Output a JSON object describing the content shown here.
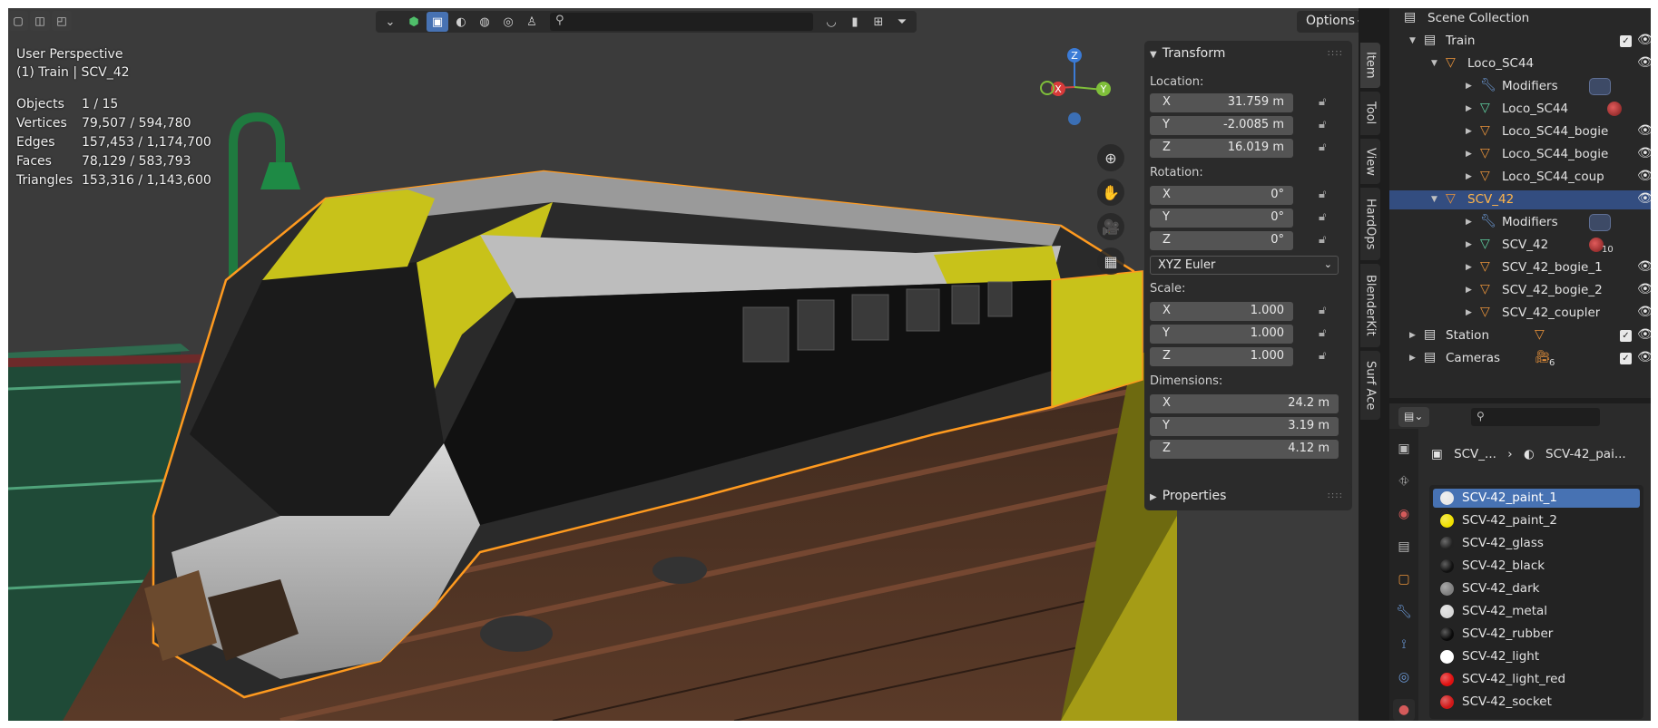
{
  "header": {
    "search_placeholder": "",
    "options_label": "Options",
    "search_icon": "search-icon"
  },
  "viewport": {
    "view_name": "User Perspective",
    "active_object": "(1) Train | SCV_42",
    "stats": [
      {
        "label": "Objects",
        "value": "1 / 15"
      },
      {
        "label": "Vertices",
        "value": "79,507 / 594,780"
      },
      {
        "label": "Edges",
        "value": "157,453 / 1,174,700"
      },
      {
        "label": "Faces",
        "value": "78,129 / 583,793"
      },
      {
        "label": "Triangles",
        "value": "153,316 / 1,143,600"
      }
    ],
    "gizmo": {
      "x": "X",
      "y": "Y",
      "z": "Z"
    }
  },
  "npanel": {
    "transform_title": "Transform",
    "location_label": "Location:",
    "location": [
      {
        "axis": "X",
        "value": "31.759 m"
      },
      {
        "axis": "Y",
        "value": "-2.0085 m"
      },
      {
        "axis": "Z",
        "value": "16.019 m"
      }
    ],
    "rotation_label": "Rotation:",
    "rotation": [
      {
        "axis": "X",
        "value": "0°"
      },
      {
        "axis": "Y",
        "value": "0°"
      },
      {
        "axis": "Z",
        "value": "0°"
      }
    ],
    "rotation_mode": "XYZ Euler",
    "scale_label": "Scale:",
    "scale": [
      {
        "axis": "X",
        "value": "1.000"
      },
      {
        "axis": "Y",
        "value": "1.000"
      },
      {
        "axis": "Z",
        "value": "1.000"
      }
    ],
    "dimensions_label": "Dimensions:",
    "dimensions": [
      {
        "axis": "X",
        "value": "24.2 m"
      },
      {
        "axis": "Y",
        "value": "3.19 m"
      },
      {
        "axis": "Z",
        "value": "4.12 m"
      }
    ],
    "properties_title": "Properties",
    "tabs": [
      "Item",
      "Tool",
      "View",
      "HardOps",
      "BlenderKit",
      "Surf Ace"
    ]
  },
  "outliner": {
    "rows": [
      {
        "label": "Scene Collection"
      },
      {
        "label": "Train"
      },
      {
        "label": "Loco_SC44"
      },
      {
        "label": "Modifiers"
      },
      {
        "label": "Loco_SC44"
      },
      {
        "label": "Loco_SC44_bogie"
      },
      {
        "label": "Loco_SC44_bogie"
      },
      {
        "label": "Loco_SC44_coup"
      },
      {
        "label": "SCV_42"
      },
      {
        "label": "Modifiers"
      },
      {
        "label": "SCV_42"
      },
      {
        "label": "SCV_42_bogie_1"
      },
      {
        "label": "SCV_42_bogie_2"
      },
      {
        "label": "SCV_42_coupler"
      },
      {
        "label": "Station"
      },
      {
        "label": "Cameras"
      }
    ],
    "mat_count": "10",
    "camera_count": "6"
  },
  "properties": {
    "breadcrumb_object": "SCV_...",
    "breadcrumb_material": "SCV-42_pai...",
    "materials": [
      {
        "name": "SCV-42_paint_1",
        "color": "#e8e8e8"
      },
      {
        "name": "SCV-42_paint_2",
        "color": "#f0e000"
      },
      {
        "name": "SCV-42_glass",
        "color": "#222222"
      },
      {
        "name": "SCV-42_black",
        "color": "#111111"
      },
      {
        "name": "SCV-42_dark",
        "color": "#808080"
      },
      {
        "name": "SCV-42_metal",
        "color": "#d8d8d8"
      },
      {
        "name": "SCV-42_rubber",
        "color": "#0a0a0a"
      },
      {
        "name": "SCV-42_light",
        "color": "#ffffff"
      },
      {
        "name": "SCV-42_light_red",
        "color": "#e01010"
      },
      {
        "name": "SCV-42_socket",
        "color": "#d01818"
      }
    ]
  },
  "colors": {
    "accent": "#4772b3",
    "selection_outline": "#ff9a1f",
    "train_yellow": "#c8c21a"
  }
}
